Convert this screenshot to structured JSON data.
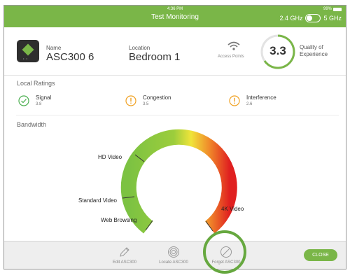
{
  "header": {
    "time": "4:36 PM",
    "title": "Test Monitoring",
    "battery": "99%",
    "band_left": "2.4 GHz",
    "band_right": "5 GHz",
    "accent_color": "#7ab648"
  },
  "device": {
    "name_label": "Name",
    "name_value": "ASC300 6",
    "location_label": "Location",
    "location_value": "Bedroom 1",
    "access_points_label": "Access Points",
    "qoe_value": "3.3",
    "qoe_label_line1": "Quality of",
    "qoe_label_line2": "Experience"
  },
  "local_ratings": {
    "title": "Local Ratings",
    "items": [
      {
        "name": "Signal",
        "value": "3.8",
        "icon": "check-circle-icon",
        "color": "#4caf50"
      },
      {
        "name": "Congestion",
        "value": "3.5",
        "icon": "warning-circle-icon",
        "color": "#f0a020"
      },
      {
        "name": "Interference",
        "value": "2.6",
        "icon": "warning-circle-icon",
        "color": "#f0a020"
      }
    ]
  },
  "bandwidth": {
    "title": "Bandwidth",
    "labels": {
      "hd_video": "HD Video",
      "standard_video": "Standard Video",
      "web_browsing": "Web Browsing",
      "k4_video": "4K Video"
    }
  },
  "toolbar": {
    "edit_label": "Edit ASC300",
    "locate_label": "Locate ASC300",
    "forget_label": "Forget ASC300",
    "close_label": "CLOSE"
  }
}
